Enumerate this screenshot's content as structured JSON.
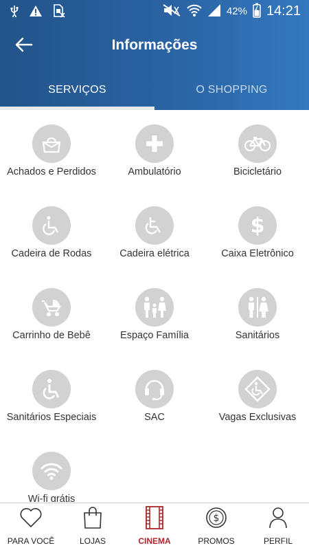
{
  "statusbar": {
    "battery": "42%",
    "time": "14:21",
    "icons": [
      "usb-icon",
      "warning-icon",
      "sim-off-icon",
      "mute-icon",
      "wifi-icon",
      "signal-icon",
      "battery-icon"
    ]
  },
  "header": {
    "title": "Informações",
    "back_icon": "arrow-left-icon"
  },
  "tabs": [
    {
      "label": "SERVIÇOS",
      "active": true
    },
    {
      "label": "O SHOPPING",
      "active": false
    }
  ],
  "services": [
    {
      "label": "Achados e Perdidos",
      "icon": "bag-icon"
    },
    {
      "label": "Ambulatório",
      "icon": "plus-icon"
    },
    {
      "label": "Bicicletário",
      "icon": "bicycle-icon"
    },
    {
      "label": "Cadeira de Rodas",
      "icon": "wheelchair-icon"
    },
    {
      "label": "Cadeira elétrica",
      "icon": "electric-wheelchair-icon"
    },
    {
      "label": "Caixa Eletrônico",
      "icon": "dollar-icon"
    },
    {
      "label": "Carrinho de Bebê",
      "icon": "stroller-icon"
    },
    {
      "label": "Espaço Família",
      "icon": "family-icon"
    },
    {
      "label": "Sanitários",
      "icon": "restroom-icon"
    },
    {
      "label": "Sanitários Especiais",
      "icon": "accessible-icon"
    },
    {
      "label": "SAC",
      "icon": "headset-icon"
    },
    {
      "label": "Vagas Exclusivas",
      "icon": "accessible-parking-icon"
    },
    {
      "label": "Wi-fi grátis",
      "icon": "wifi-icon"
    }
  ],
  "bottom_nav": [
    {
      "label": "PARA VOCÊ",
      "icon": "heart-icon",
      "active": false
    },
    {
      "label": "LOJAS",
      "icon": "shopping-bag-icon",
      "active": false
    },
    {
      "label": "CINEMA",
      "icon": "film-icon",
      "active": true
    },
    {
      "label": "PROMOS",
      "icon": "coin-icon",
      "active": false
    },
    {
      "label": "PERFIL",
      "icon": "user-icon",
      "active": false
    }
  ],
  "colors": {
    "header_start": "#22548a",
    "header_end": "#3478bf",
    "icon_circle": "#d2d2d2",
    "active_nav": "#b0252a"
  }
}
